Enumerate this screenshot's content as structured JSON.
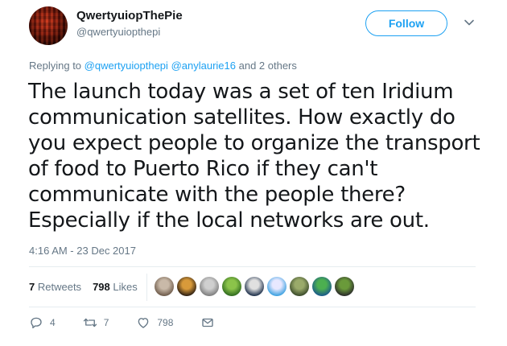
{
  "tweet": {
    "display_name": "QwertyuiopThePie",
    "handle": "@qwertyuiopthepi",
    "follow_label": "Follow",
    "replying_prefix": "Replying to",
    "replying_mentions": [
      "@qwertyuiopthepi",
      "@anylaurie16"
    ],
    "replying_suffix": "and 2 others",
    "text": "The launch today was a set of ten Iridium communication satellites. How exactly do you expect people to organize the transport of food to Puerto Rico if they can't communicate with the people there? Especially if the local networks are out.",
    "timestamp": "4:16 AM - 23 Dec 2017"
  },
  "stats": {
    "retweets_count": "7",
    "retweets_label": "Retweets",
    "likes_count": "798",
    "likes_label": "Likes"
  },
  "likers": [
    {
      "colors": [
        "#6d5a4a",
        "#c9b9a8"
      ]
    },
    {
      "colors": [
        "#2b1d12",
        "#d89a3a"
      ]
    },
    {
      "colors": [
        "#7d7d7d",
        "#cfcfcf"
      ]
    },
    {
      "colors": [
        "#2f6b1e",
        "#8bc34a"
      ]
    },
    {
      "colors": [
        "#1d2f4a",
        "#e0e0e0"
      ]
    },
    {
      "colors": [
        "#3aa0e0",
        "#e8e8ff"
      ]
    },
    {
      "colors": [
        "#3a4a2a",
        "#9aaa6a"
      ]
    },
    {
      "colors": [
        "#1a5a8a",
        "#4caf50"
      ]
    },
    {
      "colors": [
        "#2a2a2a",
        "#6a9a3a"
      ]
    }
  ],
  "actions": {
    "reply_count": "4",
    "retweet_count": "7",
    "like_count": "798"
  },
  "colors": {
    "accent": "#1da1f2",
    "muted": "#657786",
    "text": "#14171a",
    "divider": "#e6ecf0"
  }
}
